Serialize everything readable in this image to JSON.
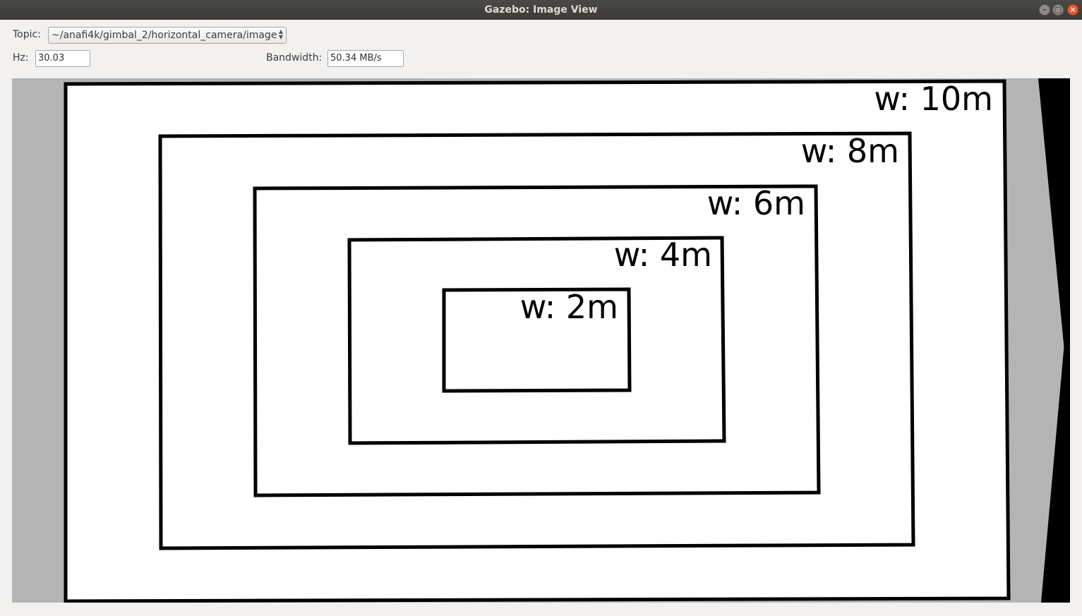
{
  "window": {
    "title": "Gazebo: Image View",
    "controls": [
      "minimize-icon",
      "maximize-icon",
      "close-icon"
    ]
  },
  "controls": {
    "topic_label": "Topic:",
    "topic_value": "~/anafi4k/gimbal_2/horizontal_camera/image",
    "hz_label": "Hz:",
    "hz_value": "30.03",
    "bandwidth_label": "Bandwidth:",
    "bandwidth_value": "50.34 MB/s"
  },
  "camera_image": {
    "markers": [
      {
        "label": "w: 10m"
      },
      {
        "label": "w: 8m"
      },
      {
        "label": "w: 6m"
      },
      {
        "label": "w: 4m"
      },
      {
        "label": "w: 2m"
      }
    ]
  },
  "colors": {
    "titlebar": "#3b3a37",
    "background": "#f2f1f0",
    "image_backdrop": "#b4b4b4",
    "close_button": "#e85a2e"
  }
}
